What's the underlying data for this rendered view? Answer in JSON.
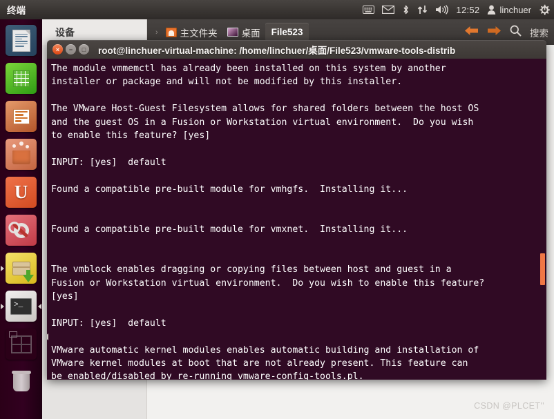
{
  "panel": {
    "app_name": "终端",
    "clock": "12:52",
    "user": "linchuer",
    "indicators": [
      {
        "name": "keyboard-icon",
        "label": "keyboard"
      },
      {
        "name": "mail-icon",
        "label": "messaging"
      },
      {
        "name": "bluetooth-icon",
        "label": "bluetooth"
      },
      {
        "name": "network-icon",
        "label": "network"
      },
      {
        "name": "volume-icon",
        "label": "sound"
      }
    ],
    "session_icon": "gear-power-icon"
  },
  "launcher": {
    "items": [
      {
        "name": "launcher-libreoffice-writer",
        "label": "LibreOffice Writer",
        "running": false
      },
      {
        "name": "launcher-libreoffice-calc",
        "label": "LibreOffice Calc",
        "running": false
      },
      {
        "name": "launcher-libreoffice-impress",
        "label": "LibreOffice Impress",
        "running": false
      },
      {
        "name": "launcher-software-center",
        "label": "Ubuntu Software Center",
        "running": false
      },
      {
        "name": "launcher-ubuntu-one",
        "label": "Ubuntu One",
        "running": false
      },
      {
        "name": "launcher-system-settings",
        "label": "System Settings",
        "running": false
      },
      {
        "name": "launcher-update-manager",
        "label": "Update Manager",
        "running": true
      },
      {
        "name": "launcher-terminal",
        "label": "Terminal",
        "running": true
      },
      {
        "name": "launcher-workspace-switcher",
        "label": "Workspace Switcher",
        "running": false
      },
      {
        "name": "launcher-trash",
        "label": "Trash",
        "running": false
      }
    ]
  },
  "nautilus": {
    "sidebar_header": "设备",
    "breadcrumb": [
      {
        "label": "主文件夹",
        "icon": "home-folder-icon",
        "active": false
      },
      {
        "label": "桌面",
        "icon": "desktop-icon",
        "active": false
      },
      {
        "label": "File523",
        "icon": "",
        "active": true
      }
    ],
    "separator": "›",
    "search_label": "搜索",
    "back_label": "后退",
    "forward_label": "前进",
    "watermark": "CSDN @PLCET''"
  },
  "terminal": {
    "title": "root@linchuer-virtual-machine: /home/linchuer/桌面/File523/vmware-tools-distrib",
    "window_buttons": {
      "close": "×",
      "minimize": "−",
      "maximize": "□"
    },
    "background_color": "#300a24",
    "foreground_color": "#ffffff",
    "scrollbar_color": "#f07746",
    "output": "The module vmmemctl has already been installed on this system by another\ninstaller or package and will not be modified by this installer.\n\nThe VMware Host-Guest Filesystem allows for shared folders between the host OS\nand the guest OS in a Fusion or Workstation virtual environment.  Do you wish\nto enable this feature? [yes]\n\nINPUT: [yes]  default\n\nFound a compatible pre-built module for vmhgfs.  Installing it...\n\n\nFound a compatible pre-built module for vmxnet.  Installing it...\n\n\nThe vmblock enables dragging or copying files between host and guest in a\nFusion or Workstation virtual environment.  Do you wish to enable this feature?\n[yes]\n\nINPUT: [yes]  default\n\nVMware automatic kernel modules enables automatic building and installation of\nVMware kernel modules at boot that are not already present. This feature can\nbe enabled/disabled by re-running vmware-config-tools.pl."
  }
}
